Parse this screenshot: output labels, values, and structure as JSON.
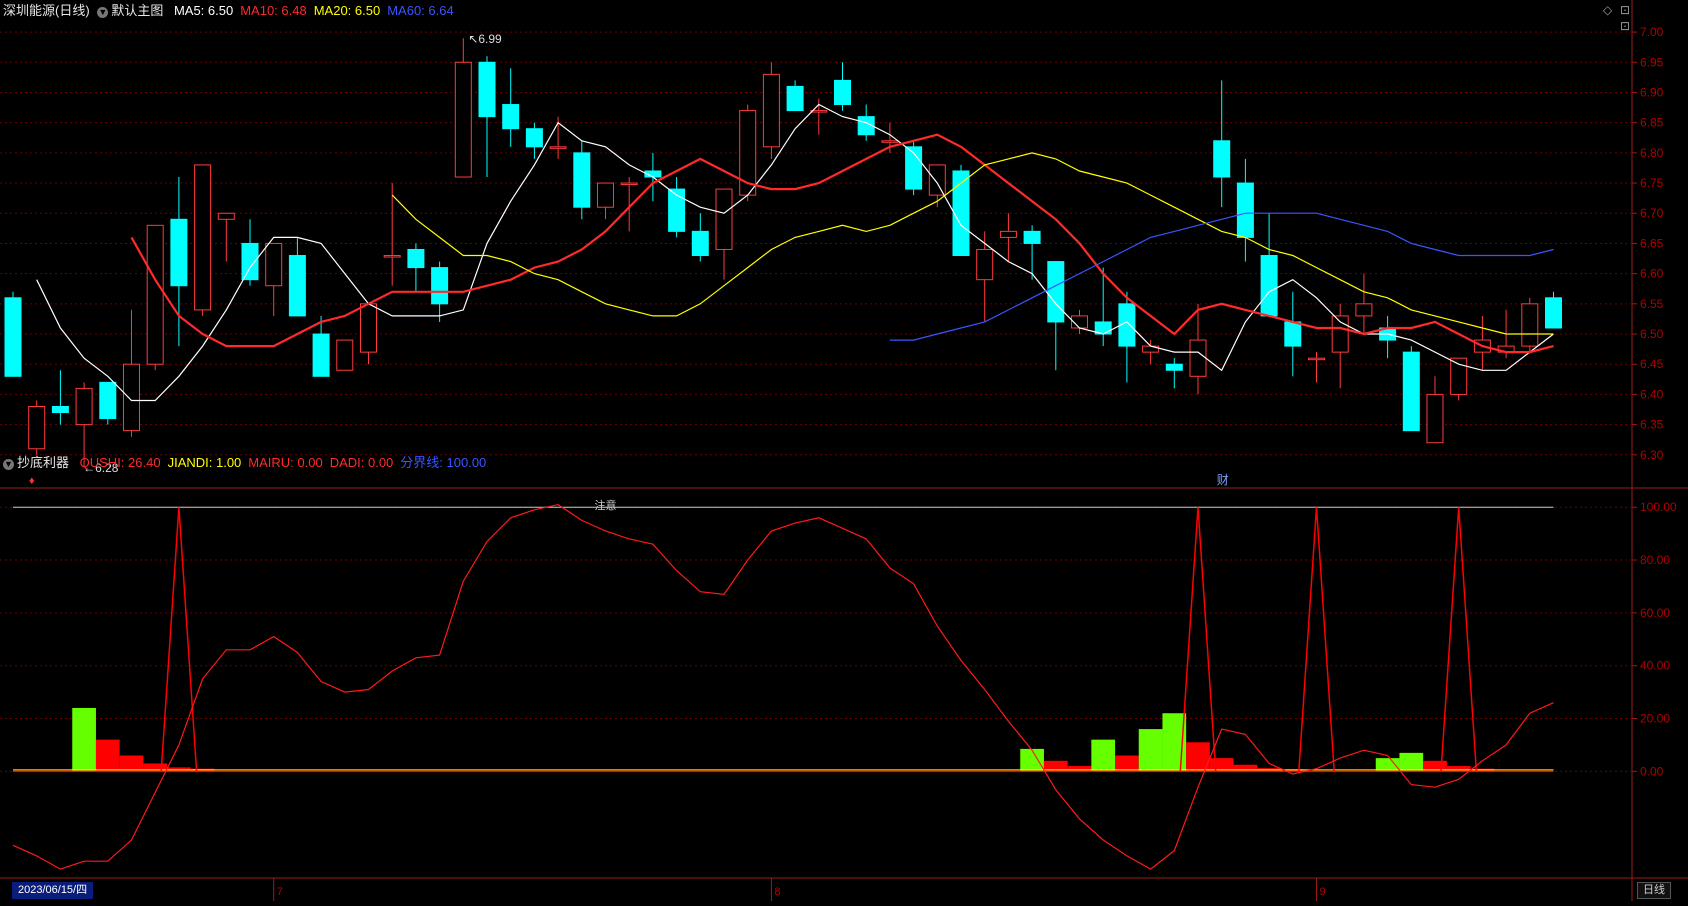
{
  "header": {
    "symbol": "深圳能源",
    "period": "(日线)",
    "template": "默认主图",
    "ma": [
      {
        "label": "MA5:",
        "value": "6.50",
        "color": "#ffffff"
      },
      {
        "label": "MA10:",
        "value": "6.48",
        "color": "#ff2a2a"
      },
      {
        "label": "MA20:",
        "value": "6.50",
        "color": "#ffff00"
      },
      {
        "label": "MA60:",
        "value": "6.64",
        "color": "#3a55ff"
      }
    ]
  },
  "indicator": {
    "name": "抄底利器",
    "items": [
      {
        "label": "QUSHI:",
        "value": "26.40",
        "color": "#ff2a2a"
      },
      {
        "label": "JIANDI:",
        "value": "1.00",
        "color": "#ffff00"
      },
      {
        "label": "MAIRU:",
        "value": "0.00",
        "color": "#ff2a2a"
      },
      {
        "label": "DADI:",
        "value": "0.00",
        "color": "#ff2a2a"
      },
      {
        "label": "分界线:",
        "value": "100.00",
        "color": "#3a55ff"
      }
    ],
    "note": "注意"
  },
  "annotations": {
    "high": "6.99",
    "low": "←6.28",
    "low_prefix": "↖",
    "marker_fin": "财"
  },
  "timeline": {
    "date_box": "2023/06/15/四",
    "months": [
      "7",
      "8",
      "9"
    ],
    "period_tab": "日线"
  },
  "colors": {
    "up": "#ff3b3b",
    "down": "#00ffff",
    "grid": "#6e0000",
    "axis": "#9b1b1b"
  },
  "chart_data": [
    {
      "type": "candlestick",
      "title": "深圳能源 (日线)",
      "ylim": [
        6.25,
        7.02
      ],
      "y_ticks": [
        "7.00",
        "6.95",
        "6.90",
        "6.85",
        "6.80",
        "6.75",
        "6.70",
        "6.65",
        "6.60",
        "6.55",
        "6.50",
        "6.45",
        "6.40",
        "6.35",
        "6.30"
      ],
      "candles": [
        [
          6.56,
          6.57,
          6.43,
          6.43
        ],
        [
          6.31,
          6.39,
          6.3,
          6.38
        ],
        [
          6.38,
          6.44,
          6.35,
          6.37
        ],
        [
          6.35,
          6.42,
          6.28,
          6.41
        ],
        [
          6.42,
          6.42,
          6.35,
          6.36
        ],
        [
          6.34,
          6.54,
          6.33,
          6.45
        ],
        [
          6.45,
          6.68,
          6.44,
          6.68
        ],
        [
          6.69,
          6.76,
          6.48,
          6.58
        ],
        [
          6.54,
          6.78,
          6.53,
          6.78
        ],
        [
          6.69,
          6.7,
          6.62,
          6.7
        ],
        [
          6.65,
          6.69,
          6.58,
          6.59
        ],
        [
          6.58,
          6.65,
          6.53,
          6.65
        ],
        [
          6.63,
          6.66,
          6.53,
          6.53
        ],
        [
          6.5,
          6.53,
          6.44,
          6.43
        ],
        [
          6.44,
          6.49,
          6.44,
          6.49
        ],
        [
          6.47,
          6.55,
          6.45,
          6.55
        ],
        [
          6.63,
          6.75,
          6.58,
          6.63
        ],
        [
          6.64,
          6.65,
          6.57,
          6.61
        ],
        [
          6.61,
          6.62,
          6.52,
          6.55
        ],
        [
          6.76,
          6.99,
          6.76,
          6.95
        ],
        [
          6.95,
          6.96,
          6.76,
          6.86
        ],
        [
          6.88,
          6.94,
          6.81,
          6.84
        ],
        [
          6.84,
          6.85,
          6.79,
          6.81
        ],
        [
          6.81,
          6.86,
          6.79,
          6.81
        ],
        [
          6.8,
          6.82,
          6.69,
          6.71
        ],
        [
          6.71,
          6.75,
          6.69,
          6.75
        ],
        [
          6.75,
          6.76,
          6.67,
          6.75
        ],
        [
          6.77,
          6.8,
          6.72,
          6.76
        ],
        [
          6.74,
          6.76,
          6.66,
          6.67
        ],
        [
          6.67,
          6.7,
          6.62,
          6.63
        ],
        [
          6.64,
          6.74,
          6.59,
          6.74
        ],
        [
          6.73,
          6.88,
          6.72,
          6.87
        ],
        [
          6.81,
          6.95,
          6.79,
          6.93
        ],
        [
          6.91,
          6.92,
          6.87,
          6.87
        ],
        [
          6.87,
          6.89,
          6.83,
          6.87
        ],
        [
          6.92,
          6.95,
          6.87,
          6.88
        ],
        [
          6.86,
          6.88,
          6.82,
          6.83
        ],
        [
          6.82,
          6.85,
          6.8,
          6.82
        ],
        [
          6.81,
          6.82,
          6.73,
          6.74
        ],
        [
          6.73,
          6.78,
          6.71,
          6.78
        ],
        [
          6.77,
          6.78,
          6.63,
          6.63
        ],
        [
          6.59,
          6.67,
          6.52,
          6.64
        ],
        [
          6.66,
          6.7,
          6.62,
          6.67
        ],
        [
          6.67,
          6.68,
          6.59,
          6.65
        ],
        [
          6.62,
          6.62,
          6.44,
          6.52
        ],
        [
          6.51,
          6.54,
          6.5,
          6.53
        ],
        [
          6.52,
          6.61,
          6.48,
          6.5
        ],
        [
          6.55,
          6.57,
          6.42,
          6.48
        ],
        [
          6.47,
          6.49,
          6.45,
          6.48
        ],
        [
          6.45,
          6.46,
          6.41,
          6.44
        ],
        [
          6.43,
          6.55,
          6.4,
          6.49
        ],
        [
          6.82,
          6.92,
          6.71,
          6.76
        ],
        [
          6.75,
          6.79,
          6.62,
          6.66
        ],
        [
          6.63,
          6.7,
          6.55,
          6.53
        ],
        [
          6.52,
          6.57,
          6.43,
          6.48
        ],
        [
          6.46,
          6.47,
          6.42,
          6.46
        ],
        [
          6.47,
          6.55,
          6.41,
          6.53
        ],
        [
          6.53,
          6.6,
          6.5,
          6.55
        ],
        [
          6.51,
          6.53,
          6.46,
          6.49
        ],
        [
          6.47,
          6.48,
          6.34,
          6.34
        ],
        [
          6.32,
          6.43,
          6.32,
          6.4
        ],
        [
          6.4,
          6.46,
          6.39,
          6.46
        ],
        [
          6.47,
          6.53,
          6.44,
          6.49
        ],
        [
          6.47,
          6.54,
          6.46,
          6.48
        ],
        [
          6.48,
          6.56,
          6.47,
          6.55
        ],
        [
          6.56,
          6.57,
          6.51,
          6.51
        ]
      ],
      "ma": {
        "MA5": {
          "color": "#ffffff",
          "values": [
            6.59,
            6.51,
            6.46,
            6.43,
            6.39,
            6.39,
            6.43,
            6.48,
            6.54,
            6.61,
            6.66,
            6.66,
            6.65,
            6.6,
            6.55,
            6.53,
            6.53,
            6.53,
            6.54,
            6.65,
            6.72,
            6.78,
            6.85,
            6.82,
            6.81,
            6.78,
            6.76,
            6.73,
            6.71,
            6.7,
            6.73,
            6.78,
            6.84,
            6.88,
            6.86,
            6.85,
            6.83,
            6.8,
            6.75,
            6.68,
            6.65,
            6.62,
            6.6,
            6.55,
            6.51,
            6.5,
            6.52,
            6.48,
            6.47,
            6.47,
            6.44,
            6.52,
            6.57,
            6.59,
            6.56,
            6.52,
            6.5,
            6.5,
            6.49,
            6.47,
            6.45,
            6.44,
            6.44,
            6.47,
            6.5
          ]
        },
        "MA10": {
          "color": "#ff2a2a",
          "values": [
            6.66,
            6.59,
            6.53,
            6.5,
            6.48,
            6.48,
            6.48,
            6.5,
            6.52,
            6.53,
            6.55,
            6.57,
            6.57,
            6.57,
            6.57,
            6.58,
            6.59,
            6.61,
            6.62,
            6.64,
            6.67,
            6.71,
            6.75,
            6.77,
            6.79,
            6.77,
            6.75,
            6.74,
            6.74,
            6.75,
            6.77,
            6.79,
            6.81,
            6.82,
            6.83,
            6.81,
            6.78,
            6.75,
            6.72,
            6.69,
            6.65,
            6.6,
            6.56,
            6.53,
            6.5,
            6.54,
            6.55,
            6.54,
            6.53,
            6.52,
            6.51,
            6.51,
            6.5,
            6.51,
            6.51,
            6.52,
            6.5,
            6.48,
            6.47,
            6.47,
            6.48
          ]
        },
        "MA20": {
          "color": "#ffff00",
          "values": [
            6.73,
            6.69,
            6.66,
            6.63,
            6.63,
            6.62,
            6.6,
            6.59,
            6.57,
            6.55,
            6.54,
            6.53,
            6.53,
            6.55,
            6.58,
            6.61,
            6.64,
            6.66,
            6.67,
            6.68,
            6.67,
            6.68,
            6.7,
            6.72,
            6.75,
            6.78,
            6.79,
            6.8,
            6.79,
            6.77,
            6.76,
            6.75,
            6.73,
            6.71,
            6.69,
            6.67,
            6.66,
            6.64,
            6.63,
            6.61,
            6.59,
            6.57,
            6.56,
            6.54,
            6.53,
            6.52,
            6.51,
            6.5,
            6.5,
            6.5
          ]
        },
        "MA60": {
          "color": "#3a55ff",
          "values": [
            6.49,
            6.49,
            6.5,
            6.51,
            6.52,
            6.54,
            6.56,
            6.58,
            6.6,
            6.62,
            6.64,
            6.66,
            6.67,
            6.68,
            6.69,
            6.7,
            6.7,
            6.7,
            6.7,
            6.69,
            6.68,
            6.67,
            6.65,
            6.64,
            6.63,
            6.63,
            6.63,
            6.63,
            6.64
          ]
        }
      },
      "high_marker": 6.99,
      "low_marker": 6.28
    },
    {
      "type": "indicator",
      "title": "抄底利器",
      "ylim": [
        -40,
        105
      ],
      "y_ticks": [
        "100.00",
        "80.00",
        "60.00",
        "40.00",
        "20.00",
        "0.00"
      ],
      "boundary": 100,
      "qushi": [
        -28,
        -32,
        -37,
        -34,
        -34,
        -26,
        -8,
        10,
        35,
        46,
        46,
        51,
        45,
        34,
        30,
        31,
        38,
        43,
        44,
        72,
        87,
        96,
        99,
        101,
        95,
        91,
        88,
        86,
        76,
        68,
        67,
        80,
        91,
        94,
        96,
        92,
        88,
        77,
        71,
        55,
        42,
        31,
        19,
        8,
        -7,
        -18,
        -26,
        -32,
        -37,
        -30,
        -6,
        16,
        14,
        3,
        -1,
        1,
        5,
        8,
        6,
        -5,
        -6,
        -3,
        4,
        10,
        22,
        26
      ],
      "spikes": [
        7,
        50,
        55,
        61
      ],
      "bars": [
        {
          "idx": 3,
          "value": 24,
          "color": "#66ff00"
        },
        {
          "idx": 4,
          "value": 12,
          "color": "#ff0000"
        },
        {
          "idx": 5,
          "value": 6,
          "color": "#ff0000"
        },
        {
          "idx": 6,
          "value": 3,
          "color": "#ff0000"
        },
        {
          "idx": 7,
          "value": 1.5,
          "color": "#ff0000"
        },
        {
          "idx": 8,
          "value": 1,
          "color": "#ff0000"
        },
        {
          "idx": 43,
          "value": 8.5,
          "color": "#66ff00"
        },
        {
          "idx": 44,
          "value": 4,
          "color": "#ff0000"
        },
        {
          "idx": 45,
          "value": 2,
          "color": "#ff0000"
        },
        {
          "idx": 46,
          "value": 12,
          "color": "#66ff00"
        },
        {
          "idx": 47,
          "value": 6,
          "color": "#ff0000"
        },
        {
          "idx": 48,
          "value": 16,
          "color": "#66ff00"
        },
        {
          "idx": 49,
          "value": 22,
          "color": "#66ff00"
        },
        {
          "idx": 50,
          "value": 11,
          "color": "#ff0000"
        },
        {
          "idx": 51,
          "value": 5,
          "color": "#ff0000"
        },
        {
          "idx": 52,
          "value": 2.5,
          "color": "#ff0000"
        },
        {
          "idx": 53,
          "value": 1.2,
          "color": "#ff0000"
        },
        {
          "idx": 54,
          "value": 0.8,
          "color": "#ff0000"
        },
        {
          "idx": 58,
          "value": 5,
          "color": "#66ff00"
        },
        {
          "idx": 59,
          "value": 7,
          "color": "#66ff00"
        },
        {
          "idx": 60,
          "value": 4,
          "color": "#ff0000"
        },
        {
          "idx": 61,
          "value": 2,
          "color": "#ff0000"
        },
        {
          "idx": 62,
          "value": 1,
          "color": "#ff0000"
        }
      ]
    }
  ]
}
